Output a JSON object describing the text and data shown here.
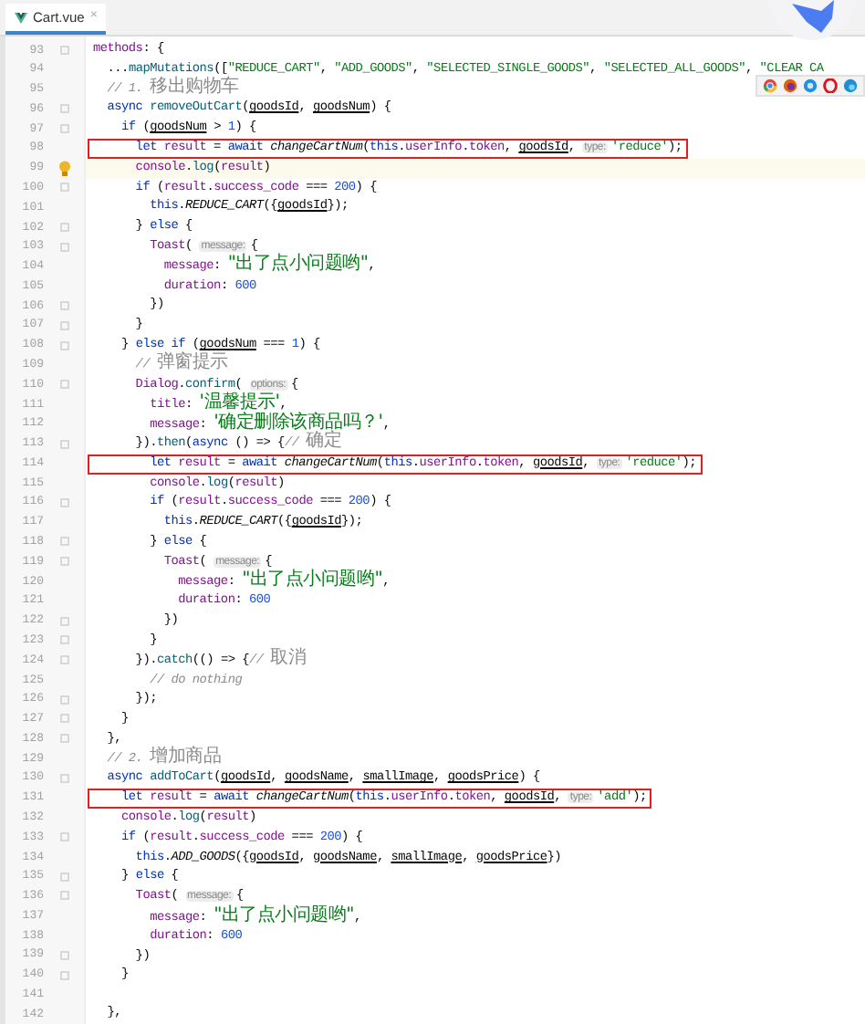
{
  "tabs": [
    {
      "title": "Cart.vue",
      "close": "×",
      "selected": true
    }
  ],
  "lines": [
    {
      "number": "93",
      "fold": true,
      "tokens": [
        {
          "kind": "prop",
          "text": "methods"
        },
        {
          "kind": "plain",
          "text": ": {"
        }
      ]
    },
    {
      "number": "94",
      "tokens": [
        {
          "kind": "plain",
          "text": "  ..."
        },
        {
          "kind": "call",
          "text": "mapMutations"
        },
        {
          "kind": "plain",
          "text": "(["
        },
        {
          "kind": "string",
          "text": "\"REDUCE_CART\""
        },
        {
          "kind": "plain",
          "text": ", "
        },
        {
          "kind": "string",
          "text": "\"ADD_GOODS\""
        },
        {
          "kind": "plain",
          "text": ", "
        },
        {
          "kind": "string",
          "text": "\"SELECTED_SINGLE_GOODS\""
        },
        {
          "kind": "plain",
          "text": ", "
        },
        {
          "kind": "string",
          "text": "\"SELECTED_ALL_GOODS\""
        },
        {
          "kind": "plain",
          "text": ", "
        },
        {
          "kind": "string",
          "text": "\"CLEAR CA"
        }
      ]
    },
    {
      "number": "95",
      "tokens": [
        {
          "kind": "comment",
          "text": "  // 1. "
        },
        {
          "kind": "comment",
          "text": "移出购物车",
          "cjk": true
        }
      ]
    },
    {
      "number": "96",
      "fold": true,
      "tokens": [
        {
          "kind": "keyword",
          "text": "  async "
        },
        {
          "kind": "call",
          "text": "removeOutCart"
        },
        {
          "kind": "plain",
          "text": "("
        },
        {
          "kind": "param",
          "text": "goodsId"
        },
        {
          "kind": "plain",
          "text": ", "
        },
        {
          "kind": "param",
          "text": "goodsNum"
        },
        {
          "kind": "plain",
          "text": ") {"
        }
      ]
    },
    {
      "number": "97",
      "fold": true,
      "tokens": [
        {
          "kind": "keyword",
          "text": "    if"
        },
        {
          "kind": "plain",
          "text": " ("
        },
        {
          "kind": "param",
          "text": "goodsNum"
        },
        {
          "kind": "plain",
          "text": " > "
        },
        {
          "kind": "number",
          "text": "1"
        },
        {
          "kind": "plain",
          "text": ") {"
        }
      ]
    },
    {
      "number": "98",
      "boxed": true,
      "tokens": [
        {
          "kind": "keyword",
          "text": "      let "
        },
        {
          "kind": "prop",
          "text": "result"
        },
        {
          "kind": "plain",
          "text": " = "
        },
        {
          "kind": "keyword",
          "text": "await "
        },
        {
          "kind": "italic",
          "text": "changeCartNum"
        },
        {
          "kind": "plain",
          "text": "("
        },
        {
          "kind": "keyword",
          "text": "this"
        },
        {
          "kind": "plain",
          "text": "."
        },
        {
          "kind": "prop",
          "text": "userInfo"
        },
        {
          "kind": "plain",
          "text": "."
        },
        {
          "kind": "prop",
          "text": "token"
        },
        {
          "kind": "plain",
          "text": ", "
        },
        {
          "kind": "param",
          "text": "goodsId"
        },
        {
          "kind": "plain",
          "text": ", "
        },
        {
          "kind": "hint",
          "text": "type:"
        },
        {
          "kind": "string",
          "text": "'reduce'"
        },
        {
          "kind": "plain",
          "text": ");"
        }
      ]
    },
    {
      "number": "99",
      "current": true,
      "bulb": true,
      "tokens": [
        {
          "kind": "prop",
          "text": "      console"
        },
        {
          "kind": "plain",
          "text": "."
        },
        {
          "kind": "call",
          "text": "log"
        },
        {
          "kind": "plain",
          "text": "("
        },
        {
          "kind": "prop",
          "text": "result"
        },
        {
          "kind": "plain",
          "text": ")"
        }
      ]
    },
    {
      "number": "100",
      "fold": true,
      "tokens": [
        {
          "kind": "keyword",
          "text": "      if"
        },
        {
          "kind": "plain",
          "text": " ("
        },
        {
          "kind": "prop",
          "text": "result"
        },
        {
          "kind": "plain",
          "text": "."
        },
        {
          "kind": "prop",
          "text": "success_code"
        },
        {
          "kind": "plain",
          "text": " === "
        },
        {
          "kind": "number",
          "text": "200"
        },
        {
          "kind": "plain",
          "text": ") {"
        }
      ]
    },
    {
      "number": "101",
      "tokens": [
        {
          "kind": "keyword",
          "text": "        this"
        },
        {
          "kind": "plain",
          "text": "."
        },
        {
          "kind": "italic",
          "text": "REDUCE_CART"
        },
        {
          "kind": "plain",
          "text": "({"
        },
        {
          "kind": "param",
          "text": "goodsId"
        },
        {
          "kind": "plain",
          "text": "});"
        }
      ]
    },
    {
      "number": "102",
      "fold": true,
      "tokens": [
        {
          "kind": "plain",
          "text": "      } "
        },
        {
          "kind": "keyword",
          "text": "else"
        },
        {
          "kind": "plain",
          "text": " {"
        }
      ]
    },
    {
      "number": "103",
      "fold": true,
      "tokens": [
        {
          "kind": "prop",
          "text": "        Toast"
        },
        {
          "kind": "plain",
          "text": "( "
        },
        {
          "kind": "hint",
          "text": "message:"
        },
        {
          "kind": "plain",
          "text": "{"
        }
      ]
    },
    {
      "number": "104",
      "tokens": [
        {
          "kind": "prop",
          "text": "          message"
        },
        {
          "kind": "plain",
          "text": ": "
        },
        {
          "kind": "string",
          "text": "\"出了点小问题哟\"",
          "cjk": true
        },
        {
          "kind": "plain",
          "text": ","
        }
      ]
    },
    {
      "number": "105",
      "tokens": [
        {
          "kind": "prop",
          "text": "          duration"
        },
        {
          "kind": "plain",
          "text": ": "
        },
        {
          "kind": "number",
          "text": "600"
        }
      ]
    },
    {
      "number": "106",
      "fold": true,
      "tokens": [
        {
          "kind": "plain",
          "text": "        })"
        }
      ]
    },
    {
      "number": "107",
      "fold": true,
      "tokens": [
        {
          "kind": "plain",
          "text": "      }"
        }
      ]
    },
    {
      "number": "108",
      "fold": true,
      "tokens": [
        {
          "kind": "plain",
          "text": "    } "
        },
        {
          "kind": "keyword",
          "text": "else if"
        },
        {
          "kind": "plain",
          "text": " ("
        },
        {
          "kind": "param",
          "text": "goodsNum"
        },
        {
          "kind": "plain",
          "text": " === "
        },
        {
          "kind": "number",
          "text": "1"
        },
        {
          "kind": "plain",
          "text": ") {"
        }
      ]
    },
    {
      "number": "109",
      "tokens": [
        {
          "kind": "comment",
          "text": "      // "
        },
        {
          "kind": "comment",
          "text": "弹窗提示",
          "cjk": true
        }
      ]
    },
    {
      "number": "110",
      "fold": true,
      "tokens": [
        {
          "kind": "prop",
          "text": "      Dialog"
        },
        {
          "kind": "plain",
          "text": "."
        },
        {
          "kind": "call",
          "text": "confirm"
        },
        {
          "kind": "plain",
          "text": "( "
        },
        {
          "kind": "hint",
          "text": "options:"
        },
        {
          "kind": "plain",
          "text": "{"
        }
      ]
    },
    {
      "number": "111",
      "tokens": [
        {
          "kind": "prop",
          "text": "        title"
        },
        {
          "kind": "plain",
          "text": ": "
        },
        {
          "kind": "string",
          "text": "'温馨提示'",
          "cjk": true
        },
        {
          "kind": "plain",
          "text": ","
        }
      ]
    },
    {
      "number": "112",
      "tokens": [
        {
          "kind": "prop",
          "text": "        message"
        },
        {
          "kind": "plain",
          "text": ": "
        },
        {
          "kind": "string",
          "text": "'确定删除该商品吗？'",
          "cjk": true
        },
        {
          "kind": "plain",
          "text": ","
        }
      ]
    },
    {
      "number": "113",
      "fold": true,
      "tokens": [
        {
          "kind": "plain",
          "text": "      })."
        },
        {
          "kind": "call",
          "text": "then"
        },
        {
          "kind": "plain",
          "text": "("
        },
        {
          "kind": "keyword",
          "text": "async"
        },
        {
          "kind": "plain",
          "text": " () => {"
        },
        {
          "kind": "comment",
          "text": "// "
        },
        {
          "kind": "comment",
          "text": "确定",
          "cjk": true
        }
      ]
    },
    {
      "number": "114",
      "boxed": true,
      "tokens": [
        {
          "kind": "keyword",
          "text": "        let "
        },
        {
          "kind": "prop",
          "text": "result"
        },
        {
          "kind": "plain",
          "text": " = "
        },
        {
          "kind": "keyword",
          "text": "await "
        },
        {
          "kind": "italic",
          "text": "changeCartNum"
        },
        {
          "kind": "plain",
          "text": "("
        },
        {
          "kind": "keyword",
          "text": "this"
        },
        {
          "kind": "plain",
          "text": "."
        },
        {
          "kind": "prop",
          "text": "userInfo"
        },
        {
          "kind": "plain",
          "text": "."
        },
        {
          "kind": "prop",
          "text": "token"
        },
        {
          "kind": "plain",
          "text": ", "
        },
        {
          "kind": "param",
          "text": "goodsId"
        },
        {
          "kind": "plain",
          "text": ", "
        },
        {
          "kind": "hint",
          "text": "type:"
        },
        {
          "kind": "string",
          "text": "'reduce'"
        },
        {
          "kind": "plain",
          "text": ");"
        }
      ]
    },
    {
      "number": "115",
      "tokens": [
        {
          "kind": "prop",
          "text": "        console"
        },
        {
          "kind": "plain",
          "text": "."
        },
        {
          "kind": "call",
          "text": "log"
        },
        {
          "kind": "plain",
          "text": "("
        },
        {
          "kind": "prop",
          "text": "result"
        },
        {
          "kind": "plain",
          "text": ")"
        }
      ]
    },
    {
      "number": "116",
      "fold": true,
      "tokens": [
        {
          "kind": "keyword",
          "text": "        if"
        },
        {
          "kind": "plain",
          "text": " ("
        },
        {
          "kind": "prop",
          "text": "result"
        },
        {
          "kind": "plain",
          "text": "."
        },
        {
          "kind": "prop",
          "text": "success_code"
        },
        {
          "kind": "plain",
          "text": " === "
        },
        {
          "kind": "number",
          "text": "200"
        },
        {
          "kind": "plain",
          "text": ") {"
        }
      ]
    },
    {
      "number": "117",
      "tokens": [
        {
          "kind": "keyword",
          "text": "          this"
        },
        {
          "kind": "plain",
          "text": "."
        },
        {
          "kind": "italic",
          "text": "REDUCE_CART"
        },
        {
          "kind": "plain",
          "text": "({"
        },
        {
          "kind": "param",
          "text": "goodsId"
        },
        {
          "kind": "plain",
          "text": "});"
        }
      ]
    },
    {
      "number": "118",
      "fold": true,
      "tokens": [
        {
          "kind": "plain",
          "text": "        } "
        },
        {
          "kind": "keyword",
          "text": "else"
        },
        {
          "kind": "plain",
          "text": " {"
        }
      ]
    },
    {
      "number": "119",
      "fold": true,
      "tokens": [
        {
          "kind": "prop",
          "text": "          Toast"
        },
        {
          "kind": "plain",
          "text": "( "
        },
        {
          "kind": "hint",
          "text": "message:"
        },
        {
          "kind": "plain",
          "text": "{"
        }
      ]
    },
    {
      "number": "120",
      "tokens": [
        {
          "kind": "prop",
          "text": "            message"
        },
        {
          "kind": "plain",
          "text": ": "
        },
        {
          "kind": "string",
          "text": "\"出了点小问题哟\"",
          "cjk": true
        },
        {
          "kind": "plain",
          "text": ","
        }
      ]
    },
    {
      "number": "121",
      "tokens": [
        {
          "kind": "prop",
          "text": "            duration"
        },
        {
          "kind": "plain",
          "text": ": "
        },
        {
          "kind": "number",
          "text": "600"
        }
      ]
    },
    {
      "number": "122",
      "fold": true,
      "tokens": [
        {
          "kind": "plain",
          "text": "          })"
        }
      ]
    },
    {
      "number": "123",
      "fold": true,
      "tokens": [
        {
          "kind": "plain",
          "text": "        }"
        }
      ]
    },
    {
      "number": "124",
      "fold": true,
      "tokens": [
        {
          "kind": "plain",
          "text": "      })."
        },
        {
          "kind": "call",
          "text": "catch"
        },
        {
          "kind": "plain",
          "text": "(() => {"
        },
        {
          "kind": "comment",
          "text": "// "
        },
        {
          "kind": "comment",
          "text": "取消",
          "cjk": true
        }
      ]
    },
    {
      "number": "125",
      "tokens": [
        {
          "kind": "comment",
          "text": "        // do nothing"
        }
      ]
    },
    {
      "number": "126",
      "fold": true,
      "tokens": [
        {
          "kind": "plain",
          "text": "      });"
        }
      ]
    },
    {
      "number": "127",
      "fold": true,
      "tokens": [
        {
          "kind": "plain",
          "text": "    }"
        }
      ]
    },
    {
      "number": "128",
      "fold": true,
      "tokens": [
        {
          "kind": "plain",
          "text": "  },"
        }
      ]
    },
    {
      "number": "129",
      "tokens": [
        {
          "kind": "comment",
          "text": "  // 2. "
        },
        {
          "kind": "comment",
          "text": "增加商品",
          "cjk": true
        }
      ]
    },
    {
      "number": "130",
      "fold": true,
      "tokens": [
        {
          "kind": "keyword",
          "text": "  async "
        },
        {
          "kind": "call",
          "text": "addToCart"
        },
        {
          "kind": "plain",
          "text": "("
        },
        {
          "kind": "param",
          "text": "goodsId"
        },
        {
          "kind": "plain",
          "text": ", "
        },
        {
          "kind": "param",
          "text": "goodsName"
        },
        {
          "kind": "plain",
          "text": ", "
        },
        {
          "kind": "param",
          "text": "smallImage"
        },
        {
          "kind": "plain",
          "text": ", "
        },
        {
          "kind": "param",
          "text": "goodsPrice"
        },
        {
          "kind": "plain",
          "text": ") {"
        }
      ]
    },
    {
      "number": "131",
      "boxed": true,
      "tokens": [
        {
          "kind": "keyword",
          "text": "    let "
        },
        {
          "kind": "prop",
          "text": "result"
        },
        {
          "kind": "plain",
          "text": " = "
        },
        {
          "kind": "keyword",
          "text": "await "
        },
        {
          "kind": "italic",
          "text": "changeCartNum"
        },
        {
          "kind": "plain",
          "text": "("
        },
        {
          "kind": "keyword",
          "text": "this"
        },
        {
          "kind": "plain",
          "text": "."
        },
        {
          "kind": "prop",
          "text": "userInfo"
        },
        {
          "kind": "plain",
          "text": "."
        },
        {
          "kind": "prop",
          "text": "token"
        },
        {
          "kind": "plain",
          "text": ", "
        },
        {
          "kind": "param",
          "text": "goodsId"
        },
        {
          "kind": "plain",
          "text": ", "
        },
        {
          "kind": "hint",
          "text": "type:"
        },
        {
          "kind": "string",
          "text": "'add'"
        },
        {
          "kind": "plain",
          "text": ");"
        }
      ]
    },
    {
      "number": "132",
      "tokens": [
        {
          "kind": "prop",
          "text": "    console"
        },
        {
          "kind": "plain",
          "text": "."
        },
        {
          "kind": "call",
          "text": "log"
        },
        {
          "kind": "plain",
          "text": "("
        },
        {
          "kind": "prop",
          "text": "result"
        },
        {
          "kind": "plain",
          "text": ")"
        }
      ]
    },
    {
      "number": "133",
      "fold": true,
      "tokens": [
        {
          "kind": "keyword",
          "text": "    if"
        },
        {
          "kind": "plain",
          "text": " ("
        },
        {
          "kind": "prop",
          "text": "result"
        },
        {
          "kind": "plain",
          "text": "."
        },
        {
          "kind": "prop",
          "text": "success_code"
        },
        {
          "kind": "plain",
          "text": " === "
        },
        {
          "kind": "number",
          "text": "200"
        },
        {
          "kind": "plain",
          "text": ") {"
        }
      ]
    },
    {
      "number": "134",
      "tokens": [
        {
          "kind": "keyword",
          "text": "      this"
        },
        {
          "kind": "plain",
          "text": "."
        },
        {
          "kind": "italic",
          "text": "ADD_GOODS"
        },
        {
          "kind": "plain",
          "text": "({"
        },
        {
          "kind": "param",
          "text": "goodsId"
        },
        {
          "kind": "plain",
          "text": ", "
        },
        {
          "kind": "param",
          "text": "goodsName"
        },
        {
          "kind": "plain",
          "text": ", "
        },
        {
          "kind": "param",
          "text": "smallImage"
        },
        {
          "kind": "plain",
          "text": ", "
        },
        {
          "kind": "param",
          "text": "goodsPrice"
        },
        {
          "kind": "plain",
          "text": "})"
        }
      ]
    },
    {
      "number": "135",
      "fold": true,
      "tokens": [
        {
          "kind": "plain",
          "text": "    } "
        },
        {
          "kind": "keyword",
          "text": "else"
        },
        {
          "kind": "plain",
          "text": " {"
        }
      ]
    },
    {
      "number": "136",
      "fold": true,
      "tokens": [
        {
          "kind": "prop",
          "text": "      Toast"
        },
        {
          "kind": "plain",
          "text": "( "
        },
        {
          "kind": "hint",
          "text": "message:"
        },
        {
          "kind": "plain",
          "text": "{"
        }
      ]
    },
    {
      "number": "137",
      "tokens": [
        {
          "kind": "prop",
          "text": "        message"
        },
        {
          "kind": "plain",
          "text": ": "
        },
        {
          "kind": "string",
          "text": "\"出了点小问题哟\"",
          "cjk": true
        },
        {
          "kind": "plain",
          "text": ","
        }
      ]
    },
    {
      "number": "138",
      "tokens": [
        {
          "kind": "prop",
          "text": "        duration"
        },
        {
          "kind": "plain",
          "text": ": "
        },
        {
          "kind": "number",
          "text": "600"
        }
      ]
    },
    {
      "number": "139",
      "fold": true,
      "tokens": [
        {
          "kind": "plain",
          "text": "      })"
        }
      ]
    },
    {
      "number": "140",
      "fold": true,
      "tokens": [
        {
          "kind": "plain",
          "text": "    }"
        }
      ]
    },
    {
      "number": "141"
    },
    {
      "number": "142",
      "tokens": [
        {
          "kind": "plain",
          "text": "  },"
        }
      ]
    }
  ]
}
